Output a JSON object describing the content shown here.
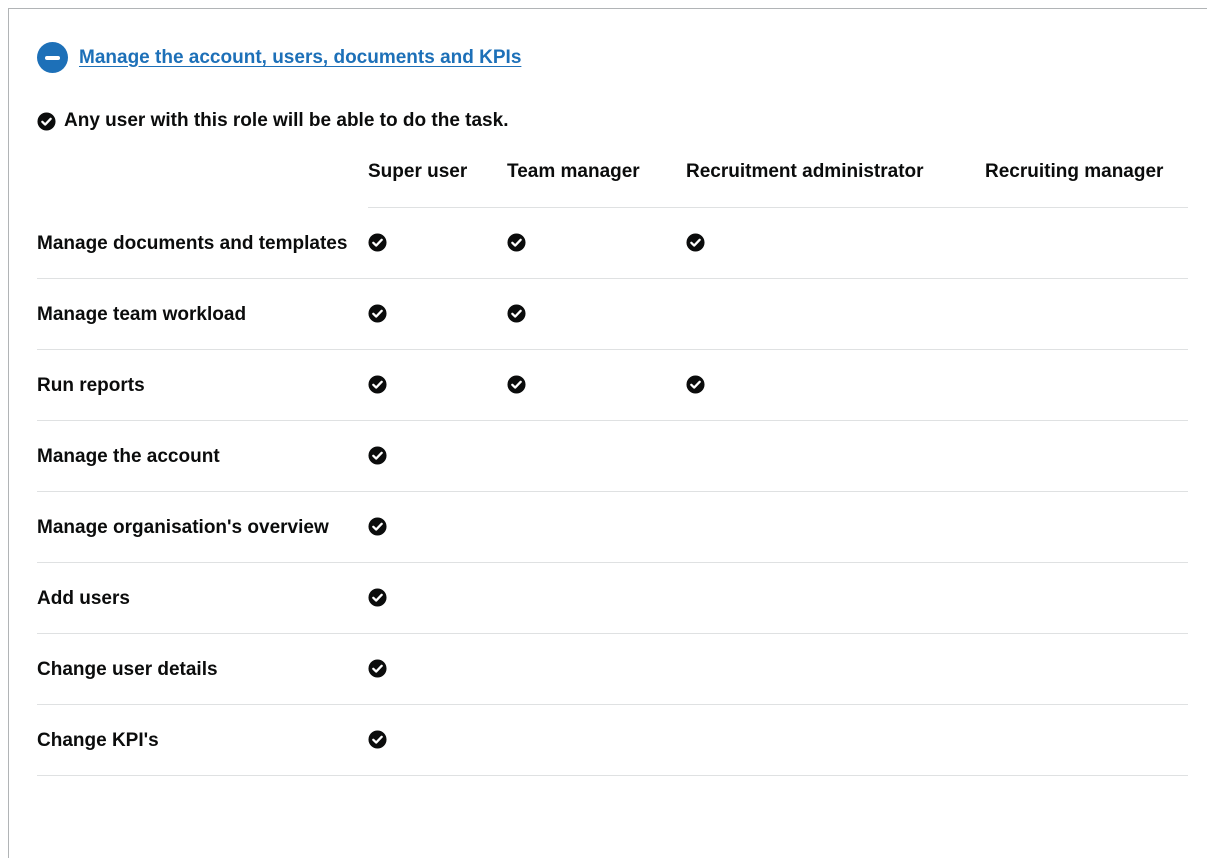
{
  "section": {
    "link_text": "Manage the account, users, documents and KPIs",
    "expanded": true
  },
  "legend": {
    "text": "Any user with this role will be able to do the task."
  },
  "table": {
    "columns": [
      "Super user",
      "Team manager",
      "Recruitment administrator",
      "Recruiting manager"
    ],
    "rows": [
      {
        "task": "Manage documents and templates",
        "permissions": [
          true,
          true,
          true,
          false
        ]
      },
      {
        "task": "Manage team workload",
        "permissions": [
          true,
          true,
          false,
          false
        ]
      },
      {
        "task": "Run reports",
        "permissions": [
          true,
          true,
          true,
          false
        ]
      },
      {
        "task": "Manage the account",
        "permissions": [
          true,
          false,
          false,
          false
        ]
      },
      {
        "task": "Manage organisation's overview",
        "permissions": [
          true,
          false,
          false,
          false
        ]
      },
      {
        "task": "Add users",
        "permissions": [
          true,
          false,
          false,
          false
        ]
      },
      {
        "task": "Change user details",
        "permissions": [
          true,
          false,
          false,
          false
        ]
      },
      {
        "task": "Change KPI's",
        "permissions": [
          true,
          false,
          false,
          false
        ]
      }
    ]
  },
  "icons": {
    "toggle": "minus-circle-icon",
    "check": "check-circle-icon"
  },
  "colors": {
    "link": "#1d70b8",
    "text": "#0b0c0c",
    "border": "#dfe1e2"
  }
}
